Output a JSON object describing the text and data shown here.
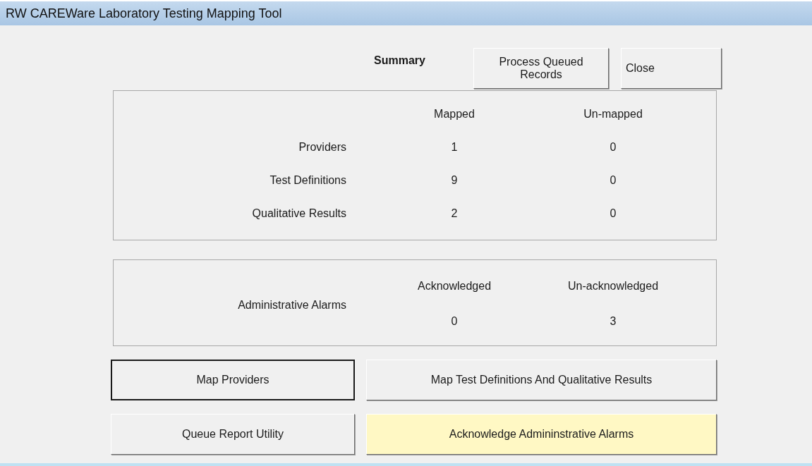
{
  "window": {
    "title": "RW CAREWare Laboratory Testing Mapping Tool"
  },
  "summary": {
    "heading": "Summary"
  },
  "top_buttons": [
    {
      "label": "Process Queued Records",
      "focused": false,
      "highlighted": false
    },
    {
      "label": "Close",
      "focused": false,
      "highlighted": false
    }
  ],
  "mapping_table": {
    "columns": [
      "Mapped",
      "Un-mapped"
    ],
    "rows": [
      {
        "label": "Providers",
        "values": [
          "1",
          "0"
        ]
      },
      {
        "label": "Test Definitions",
        "values": [
          "9",
          "0"
        ]
      },
      {
        "label": "Qualitative Results",
        "values": [
          "2",
          "0"
        ]
      }
    ]
  },
  "alarms_table": {
    "label": "Administrative Alarms",
    "columns": [
      "Acknowledged",
      "Un-acknowledged"
    ],
    "values": [
      "0",
      "3"
    ]
  },
  "action_buttons": [
    {
      "label": "Map Providers",
      "focused": true,
      "highlighted": false
    },
    {
      "label": "Map Test Definitions And Qualitative Results",
      "focused": false,
      "highlighted": false
    },
    {
      "label": "Queue Report Utility",
      "focused": false,
      "highlighted": false
    },
    {
      "label": "Acknowledge Admininstrative Alarms",
      "focused": false,
      "highlighted": true
    }
  ]
}
